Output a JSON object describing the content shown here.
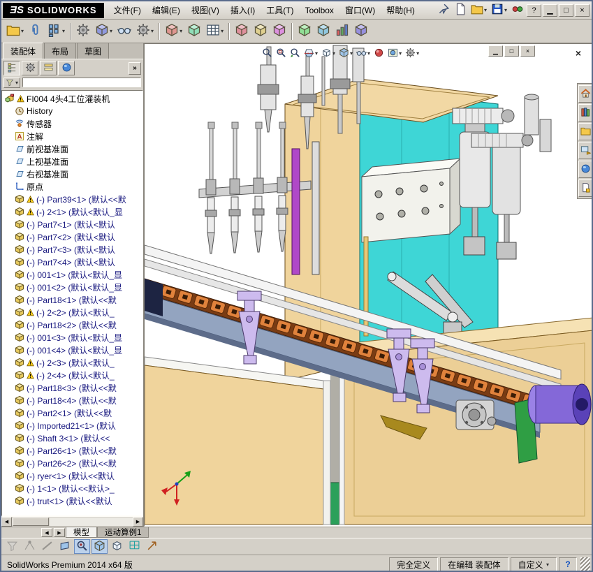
{
  "titlebar": {
    "brand_mark": "ƎS",
    "brand": "SOLIDWORKS",
    "menus": [
      "文件(F)",
      "编辑(E)",
      "视图(V)",
      "插入(I)",
      "工具(T)",
      "Toolbox",
      "窗口(W)",
      "帮助(H)"
    ],
    "quick_icons": [
      {
        "name": "menu-pin"
      },
      {
        "name": "new-document"
      },
      {
        "name": "open-document",
        "caret": true
      },
      {
        "name": "save-document",
        "caret": true
      },
      {
        "name": "status-lights"
      }
    ],
    "window_buttons": [
      {
        "name": "help",
        "glyph": "?"
      },
      {
        "name": "minimize",
        "glyph": "▁"
      },
      {
        "name": "maximize",
        "glyph": "□"
      },
      {
        "name": "close",
        "glyph": "×"
      }
    ]
  },
  "toolbar": {
    "icons": [
      {
        "name": "insert-components",
        "caret": true
      },
      {
        "name": "mate"
      },
      {
        "name": "linear-component-pattern",
        "caret": true
      },
      {
        "name": "smart-fasteners"
      },
      {
        "name": "move-component",
        "caret": true
      },
      {
        "name": "show-hidden-components"
      },
      {
        "name": "assembly-features",
        "caret": true
      },
      {
        "name": "reference-geometry",
        "caret": true
      },
      {
        "name": "new-motion-study"
      },
      {
        "name": "bill-of-materials",
        "caret": true
      },
      {
        "name": "exploded-view"
      },
      {
        "name": "explode-line-sketch"
      },
      {
        "name": "interference-detection"
      },
      {
        "name": "clearance-verification"
      },
      {
        "name": "hole-alignment"
      },
      {
        "name": "assembly-visualization"
      },
      {
        "name": "instant-3d"
      }
    ]
  },
  "command_tabs": [
    {
      "label": "装配体",
      "active": true
    },
    {
      "label": "布局",
      "active": false
    },
    {
      "label": "草图",
      "active": false
    }
  ],
  "panel": {
    "manager_tabs": [
      "featuremanager",
      "propertymanager",
      "configurationmanager",
      "displaymanager"
    ],
    "expand_glyph": "»"
  },
  "feature_tree": {
    "items": [
      {
        "icon": "assembly",
        "label": "FI004 4头4工位灌装机",
        "warning": true,
        "indent": 0,
        "blue": false
      },
      {
        "icon": "history",
        "label": "History",
        "indent": 1,
        "blue": false
      },
      {
        "icon": "sensor",
        "label": "传感器",
        "indent": 1,
        "blue": false
      },
      {
        "icon": "annotation",
        "label": "注解",
        "indent": 1,
        "blue": false
      },
      {
        "icon": "plane",
        "label": "前视基准面",
        "indent": 1,
        "blue": false
      },
      {
        "icon": "plane",
        "label": "上视基准面",
        "indent": 1,
        "blue": false
      },
      {
        "icon": "plane",
        "label": "右视基准面",
        "indent": 1,
        "blue": false
      },
      {
        "icon": "origin",
        "label": "原点",
        "indent": 1,
        "blue": false
      },
      {
        "icon": "part",
        "label": "(-) Part39<1> (默认<<默",
        "warning": true,
        "indent": 1,
        "blue": true
      },
      {
        "icon": "part",
        "label": "(-) 2<1> (默认<默认_显",
        "warning": true,
        "indent": 1,
        "blue": true
      },
      {
        "icon": "part",
        "label": "(-) Part7<1> (默认<默认",
        "indent": 1,
        "blue": true
      },
      {
        "icon": "part",
        "label": "(-) Part7<2> (默认<默认",
        "indent": 1,
        "blue": true
      },
      {
        "icon": "part",
        "label": "(-) Part7<3> (默认<默认",
        "indent": 1,
        "blue": true
      },
      {
        "icon": "part",
        "label": "(-) Part7<4> (默认<默认",
        "indent": 1,
        "blue": true
      },
      {
        "icon": "part",
        "label": "(-) 001<1> (默认<默认_显",
        "indent": 1,
        "blue": true
      },
      {
        "icon": "part",
        "label": "(-) 001<2> (默认<默认_显",
        "indent": 1,
        "blue": true
      },
      {
        "icon": "part",
        "label": "(-) Part18<1> (默认<<默",
        "indent": 1,
        "blue": true
      },
      {
        "icon": "part",
        "label": "(-) 2<2> (默认<默认_",
        "warning": true,
        "indent": 1,
        "blue": true
      },
      {
        "icon": "part",
        "label": "(-) Part18<2> (默认<<默",
        "indent": 1,
        "blue": true
      },
      {
        "icon": "part",
        "label": "(-) 001<3> (默认<默认_显",
        "indent": 1,
        "blue": true
      },
      {
        "icon": "part",
        "label": "(-) 001<4> (默认<默认_显",
        "indent": 1,
        "blue": true
      },
      {
        "icon": "part",
        "label": "(-) 2<3> (默认<默认_",
        "warning": true,
        "indent": 1,
        "blue": true
      },
      {
        "icon": "part",
        "label": "(-) 2<4> (默认<默认_",
        "warning": true,
        "indent": 1,
        "blue": true
      },
      {
        "icon": "part",
        "label": "(-) Part18<3> (默认<<默",
        "indent": 1,
        "blue": true
      },
      {
        "icon": "part",
        "label": "(-) Part18<4> (默认<<默",
        "indent": 1,
        "blue": true
      },
      {
        "icon": "part",
        "label": "(-) Part2<1> (默认<<默",
        "indent": 1,
        "blue": true
      },
      {
        "icon": "part",
        "label": "(-) Imported21<1> (默认",
        "indent": 1,
        "blue": true
      },
      {
        "icon": "part",
        "label": "(-) Shaft 3<1> (默认<<",
        "indent": 1,
        "blue": true
      },
      {
        "icon": "part",
        "label": "(-) Part26<1> (默认<<默",
        "indent": 1,
        "blue": true
      },
      {
        "icon": "part",
        "label": "(-) Part26<2> (默认<<默",
        "indent": 1,
        "blue": true
      },
      {
        "icon": "part",
        "label": "(-) ryer<1> (默认<<默认",
        "indent": 1,
        "blue": true
      },
      {
        "icon": "part",
        "label": "(-) 1<1> (默认<<默认>_",
        "indent": 1,
        "blue": true
      },
      {
        "icon": "part",
        "label": "(-) trut<1> (默认<<默认",
        "indent": 1,
        "blue": true
      }
    ]
  },
  "viewport": {
    "headsup": [
      {
        "name": "zoom-fit"
      },
      {
        "name": "zoom-to-area"
      },
      {
        "name": "previous-view"
      },
      {
        "name": "section-view",
        "caret": true
      },
      {
        "name": "view-orientation",
        "caret": true
      },
      {
        "name": "display-style",
        "caret": true
      },
      {
        "name": "hide-show-items",
        "caret": true
      },
      {
        "name": "edit-appearance"
      },
      {
        "name": "apply-scene",
        "caret": true
      },
      {
        "name": "view-settings",
        "caret": true
      }
    ],
    "taskpane": [
      "solidworks-resources",
      "design-library",
      "file-explorer",
      "view-palette",
      "appearances-scenes",
      "custom-properties"
    ],
    "mdi_buttons": [
      {
        "name": "minimize-document",
        "glyph": "▁"
      },
      {
        "name": "restore-document",
        "glyph": "□"
      },
      {
        "name": "close-document",
        "glyph": "×"
      }
    ],
    "close_glyph": "×"
  },
  "model_tabs": {
    "nav": [
      {
        "name": "tab-scroll-left",
        "glyph": "◀"
      },
      {
        "name": "tab-scroll-right",
        "glyph": "▶"
      }
    ],
    "tabs": [
      {
        "label": "模型",
        "active": true
      },
      {
        "label": "运动算例1",
        "active": false
      }
    ]
  },
  "bottom_toolbar": [
    {
      "name": "selection-filters",
      "disabled": true
    },
    {
      "name": "filter-vertices",
      "disabled": true
    },
    {
      "name": "filter-edges",
      "disabled": true
    },
    {
      "name": "filter-faces"
    },
    {
      "name": "zoom-to-selection",
      "active": true
    },
    {
      "name": "view-shaded-with-edges",
      "active": true
    },
    {
      "name": "view-orientation-cube"
    },
    {
      "name": "display-grid"
    },
    {
      "name": "quick-snaps"
    }
  ],
  "status_bar": {
    "product": "SolidWorks Premium 2014 x64 版",
    "state": "完全定义",
    "editing": "在编辑 装配体",
    "custom": "自定义",
    "custom_caret": "▾",
    "help_glyph": "?"
  }
}
